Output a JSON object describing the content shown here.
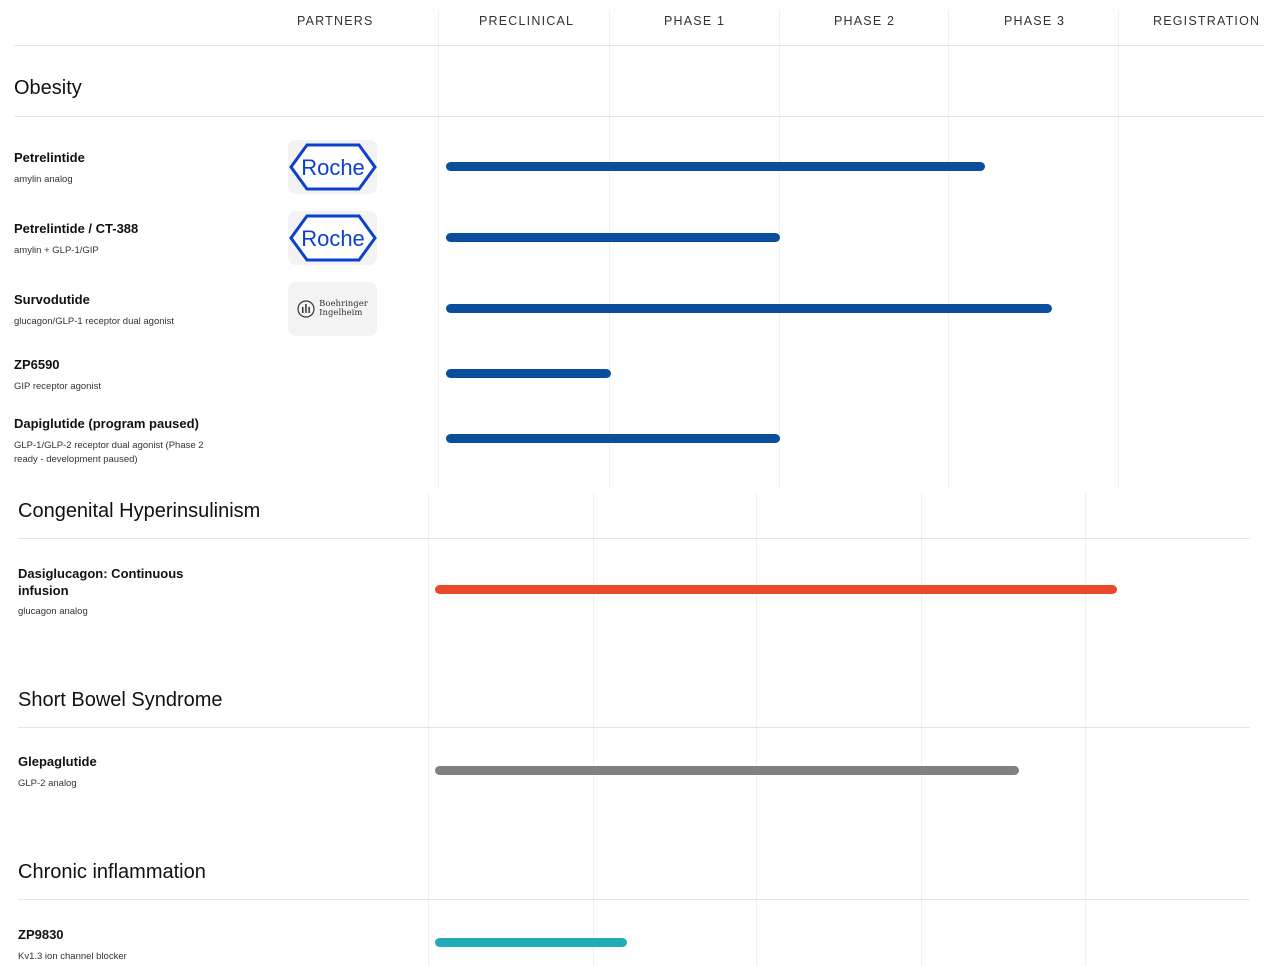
{
  "columns": {
    "partners": "PARTNERS",
    "preclinical": "PRECLINICAL",
    "phase1": "PHASE 1",
    "phase2": "PHASE 2",
    "phase3": "PHASE 3",
    "registration": "REGISTRATION"
  },
  "partners": {
    "roche": "Roche",
    "boehringer_line1": "Boehringer",
    "boehringer_line2": "Ingelheim"
  },
  "sections": [
    {
      "title": "Obesity",
      "programs": [
        {
          "name": "Petrelintide",
          "desc": "amylin analog",
          "partner": "Roche",
          "progress_pct": 66.7,
          "color": "#0b4f9c"
        },
        {
          "name": "Petrelintide / CT-388",
          "desc": "amylin + GLP-1/GIP",
          "partner": "Roche",
          "progress_pct": 41.3,
          "color": "#0b4f9c"
        },
        {
          "name": "Survodutide",
          "desc": "glucagon/GLP-1 receptor dual agonist",
          "partner": "Boehringer Ingelheim",
          "progress_pct": 75.0,
          "color": "#0b4f9c"
        },
        {
          "name": "ZP6590",
          "desc": "GIP receptor agonist",
          "progress_pct": 20.4,
          "color": "#0b4f9c"
        },
        {
          "name": "Dapiglutide (program paused)",
          "desc": "GLP-1/GLP-2 receptor dual agonist (Phase 2 ready - development paused)",
          "progress_pct": 41.3,
          "color": "#0b4f9c"
        }
      ]
    },
    {
      "title": "Congenital Hyperinsulinism",
      "programs": [
        {
          "name": "Dasiglucagon: Continuous infusion",
          "desc": "glucagon analog",
          "progress_pct": 83.7,
          "color": "#ea4a2c"
        }
      ]
    },
    {
      "title": "Short Bowel Syndrome",
      "programs": [
        {
          "name": "Glepaglutide",
          "desc": "GLP-2 analog",
          "progress_pct": 71.6,
          "color": "#808080"
        }
      ]
    },
    {
      "title": "Chronic inflammation",
      "programs": [
        {
          "name": "ZP9830",
          "desc": "Kv1.3 ion channel blocker",
          "progress_pct": 23.6,
          "color": "#22adb6"
        }
      ]
    }
  ]
}
